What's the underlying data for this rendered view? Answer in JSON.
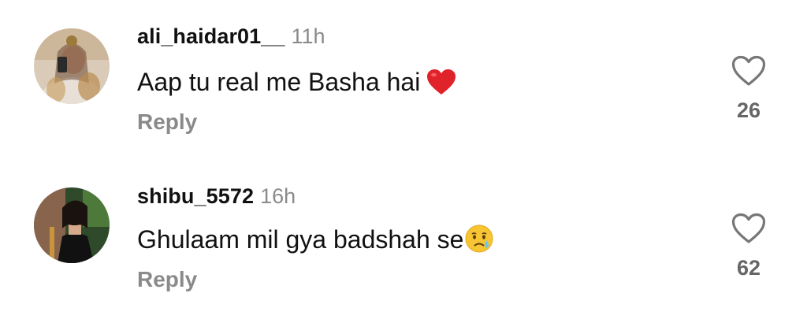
{
  "comments": [
    {
      "username": "ali_haidar01__",
      "time": "11h",
      "text": "Aap tu real me Basha hai",
      "emoji_icon": "red-heart-emoji",
      "reply_label": "Reply",
      "like_icon": "heart-outline-icon",
      "like_count": "26"
    },
    {
      "username": "shibu_5572",
      "time": "16h",
      "text": "Ghulaam mil gya badshah se",
      "emoji_icon": "crying-face-emoji",
      "reply_label": "Reply",
      "like_icon": "heart-outline-icon",
      "like_count": "62"
    }
  ],
  "colors": {
    "text": "#111111",
    "secondary": "#8a8a8a",
    "count": "#666666",
    "heart_emoji": "#e0222b",
    "background": "#ffffff"
  }
}
